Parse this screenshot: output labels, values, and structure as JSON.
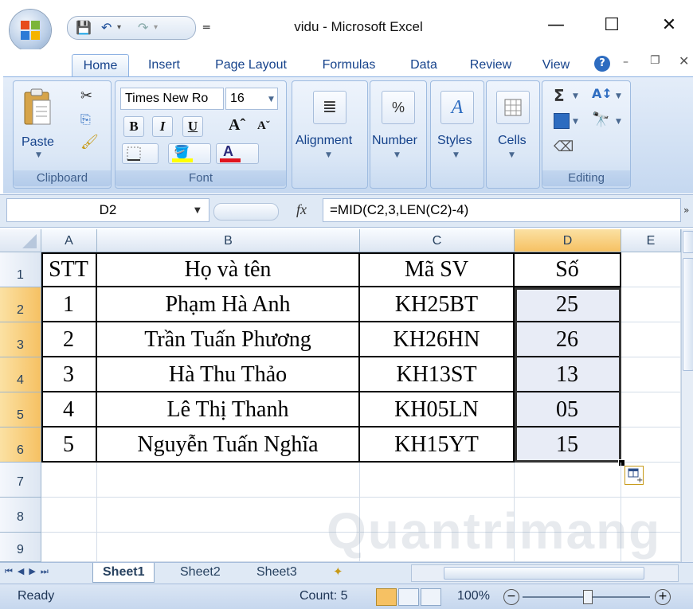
{
  "window": {
    "title": "vidu - Microsoft Excel",
    "minimize": "—",
    "maximize": "☐",
    "close": "✕"
  },
  "tabs": [
    "Home",
    "Insert",
    "Page Layout",
    "Formulas",
    "Data",
    "Review",
    "View"
  ],
  "ribbon": {
    "clipboard": {
      "label": "Clipboard",
      "paste": "Paste"
    },
    "font": {
      "label": "Font",
      "name": "Times New Ro",
      "size": "16",
      "bold": "B",
      "italic": "I",
      "underline": "U"
    },
    "alignment": {
      "label": "Alignment"
    },
    "number": {
      "label": "Number",
      "icon_text": "%"
    },
    "styles": {
      "label": "Styles"
    },
    "cells": {
      "label": "Cells"
    },
    "editing": {
      "label": "Editing"
    }
  },
  "formula_bar": {
    "name_box": "D2",
    "fx": "fx",
    "formula": "=MID(C2,3,LEN(C2)-4)"
  },
  "sheet": {
    "columns": [
      "A",
      "B",
      "C",
      "D",
      "E"
    ],
    "row_numbers": [
      "1",
      "2",
      "3",
      "4",
      "5",
      "6",
      "7",
      "8",
      "9"
    ],
    "rows": [
      [
        "STT",
        "Họ và tên",
        "Mã SV",
        "Số"
      ],
      [
        "1",
        "Phạm Hà Anh",
        "KH25BT",
        "25"
      ],
      [
        "2",
        "Trần Tuấn Phương",
        "KH26HN",
        "26"
      ],
      [
        "3",
        "Hà Thu Thảo",
        "KH13ST",
        "13"
      ],
      [
        "4",
        "Lê Thị Thanh",
        "KH05LN",
        "05"
      ],
      [
        "5",
        "Nguyễn Tuấn Nghĩa",
        "KH15YT",
        "15"
      ]
    ],
    "selected_column": "D"
  },
  "sheet_tabs": [
    "Sheet1",
    "Sheet2",
    "Sheet3"
  ],
  "status": {
    "ready": "Ready",
    "count": "Count: 5",
    "zoom": "100%"
  },
  "watermark": "Quantrimang"
}
